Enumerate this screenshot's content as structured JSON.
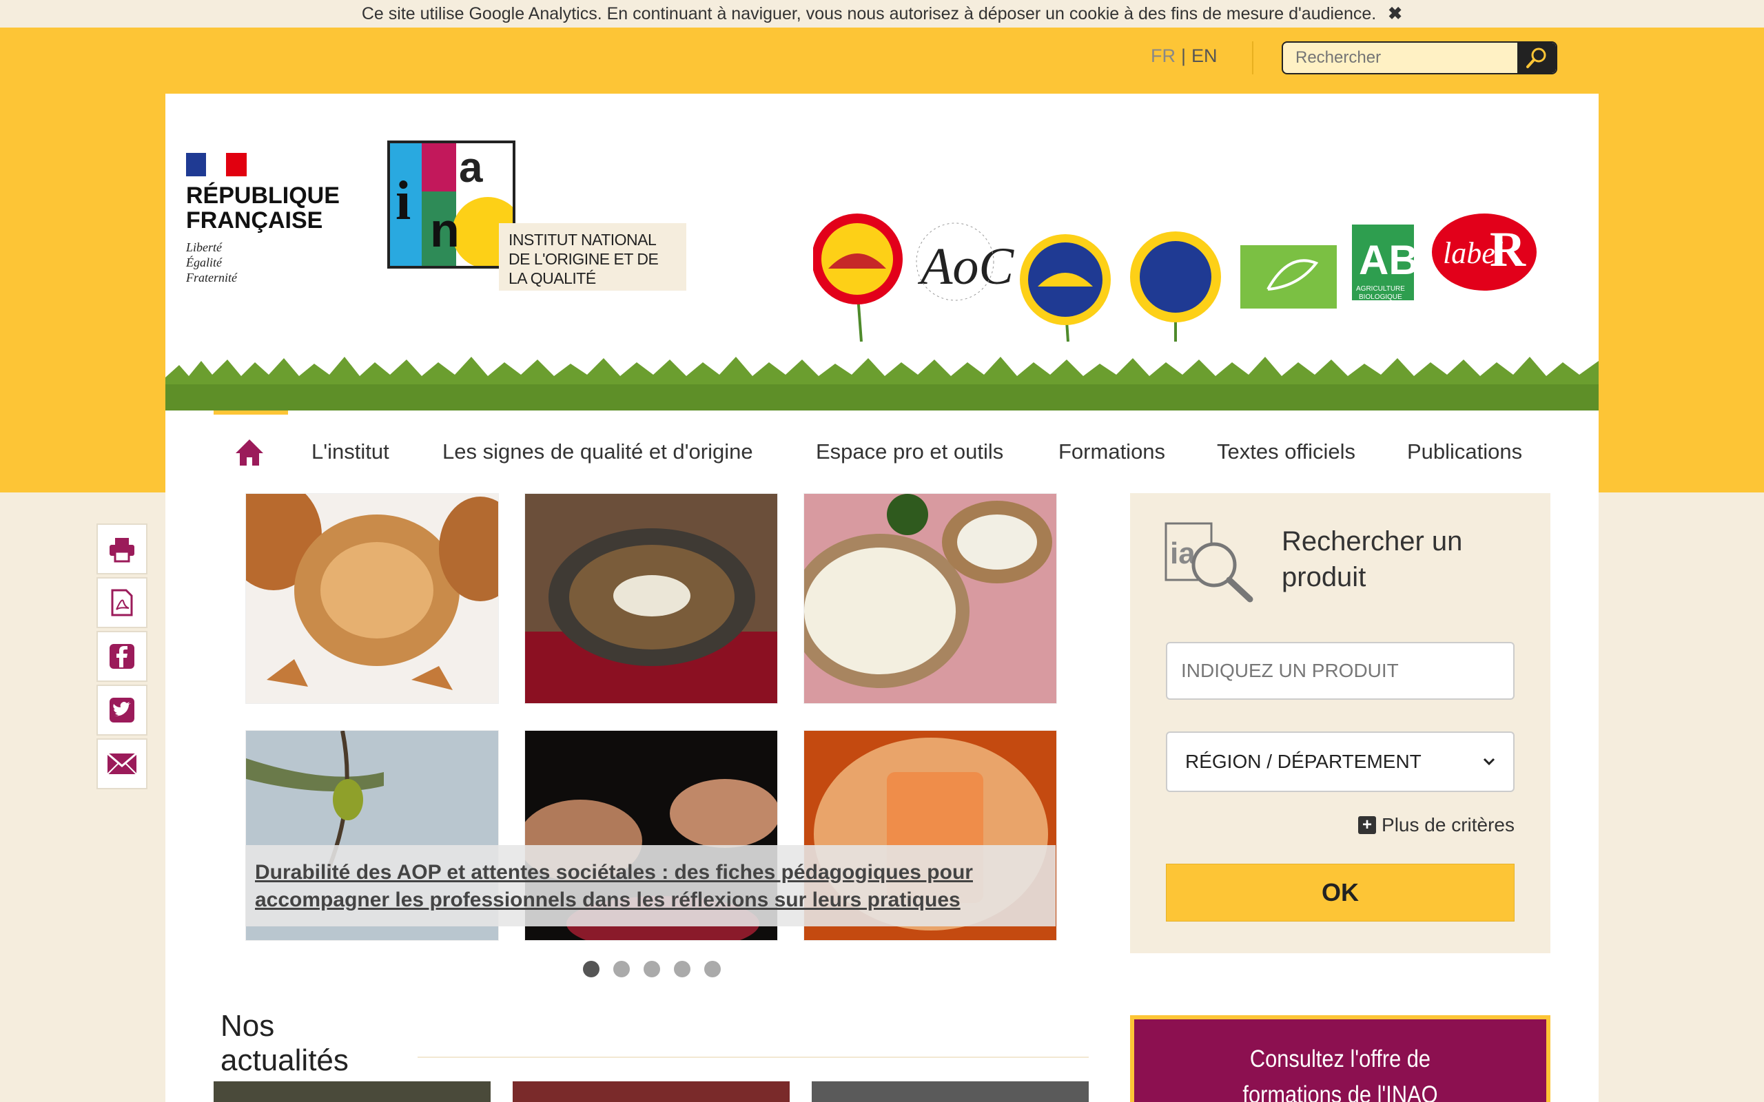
{
  "cookie_bar": {
    "message": "Ce site utilise Google Analytics. En continuant à naviguer, vous nous autorisez à déposer un cookie à des fins de mesure d'audience.",
    "close_icon": "✖"
  },
  "lang": {
    "fr": "FR",
    "separator": "|",
    "en": "EN"
  },
  "top_search": {
    "placeholder": "Rechercher"
  },
  "header": {
    "rf_title_line1": "RÉPUBLIQUE",
    "rf_title_line2": "FRANÇAISE",
    "rf_motto_1": "Liberté",
    "rf_motto_2": "Égalité",
    "rf_motto_3": "Fraternité",
    "inao_caption": "INSTITUT NATIONAL DE L'ORIGINE ET DE LA QUALITÉ",
    "quality_labels": [
      "AOP",
      "AOC",
      "IGP",
      "STG",
      "Eurofeuille",
      "AB",
      "Label Rouge"
    ]
  },
  "nav": {
    "items": [
      "L'institut",
      "Les signes de qualité et d'origine",
      "Espace pro et outils",
      "Formations",
      "Textes officiels",
      "Publications"
    ]
  },
  "share": [
    "print-icon",
    "pdf-icon",
    "facebook-icon",
    "twitter-icon",
    "email-icon"
  ],
  "slider": {
    "caption": "Durabilité des AOP et attentes sociétales : des fiches pédagogiques pour accompagner les professionnels dans les réflexions sur leurs pratiques",
    "dots": 5,
    "active_dot": 1
  },
  "news": {
    "title": "Nos actualités"
  },
  "product_search": {
    "title": "Rechercher un produit",
    "product_placeholder": "INDIQUEZ UN PRODUIT",
    "region_select": "RÉGION / DÉPARTEMENT",
    "more_criteria": "Plus de critères",
    "ok": "OK"
  },
  "formations": {
    "line1": "Consultez l'offre de",
    "line2": "formations de l'INAO"
  },
  "colors": {
    "accent_yellow": "#fdc536",
    "brand_purple": "#8c1050",
    "cream": "#f5eddd"
  }
}
